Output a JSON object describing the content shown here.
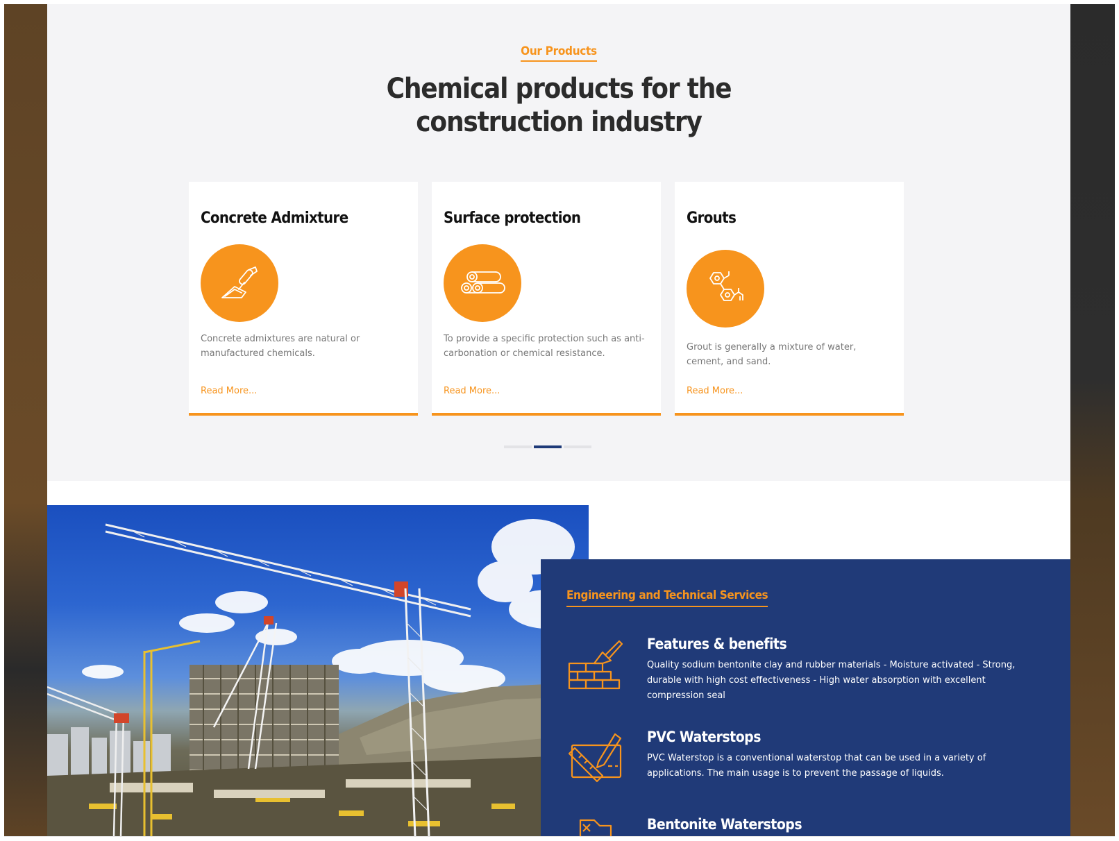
{
  "products": {
    "eyebrow": "Our Products",
    "heading_line1": "Chemical products for the",
    "heading_line2": "construction industry",
    "cards": [
      {
        "title": "Concrete Admixture",
        "icon": "trowel-icon",
        "description": "Concrete admixtures are natural or manufactured chemicals.",
        "link": "Read More..."
      },
      {
        "title": "Surface protection",
        "icon": "pipes-icon",
        "description": "To provide a specific protection such as anti-carbonation or chemical resistance.",
        "link": "Read More..."
      },
      {
        "title": "Grouts",
        "icon": "molecule-icon",
        "description": "Grout is generally a mixture of water, cement, and sand.",
        "link": "Read More..."
      }
    ],
    "carousel": {
      "pages": 3,
      "active_page": 2
    }
  },
  "services": {
    "eyebrow": "Engineering and Technical Services",
    "items": [
      {
        "title": "Features & benefits",
        "icon": "brick-wall-trowel-icon",
        "description": "Quality sodium bentonite clay and rubber materials - Moisture activated - Strong, durable with high cost effectiveness - High water absorption with excellent compression seal"
      },
      {
        "title": "PVC Waterstops",
        "icon": "ruler-pencil-icon",
        "description": "PVC Waterstop is a conventional waterstop that can be used in a variety of applications. The main usage is to prevent the passage of liquids."
      },
      {
        "title": "Bentonite Waterstops",
        "icon": "truck-icon",
        "description": ""
      }
    ]
  },
  "colors": {
    "accent": "#f7941d",
    "navy": "#203a78",
    "section_bg": "#f4f4f6",
    "heading": "#2b2b2b"
  },
  "image": {
    "subject": "construction-site-with-cranes-photo"
  }
}
